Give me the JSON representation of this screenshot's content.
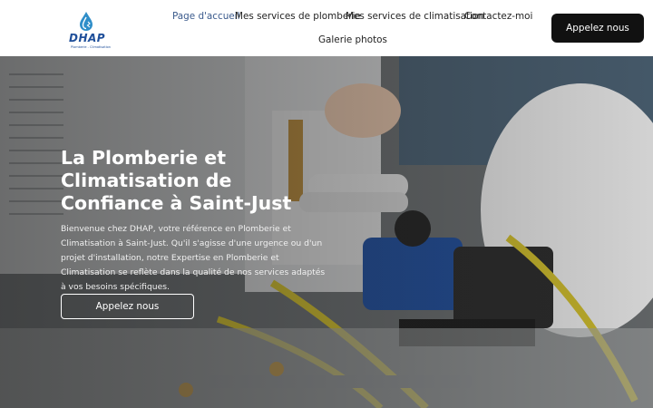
{
  "brand": {
    "logo_text": "DHAP",
    "logo_subtitle": "Plomberie - Climatisation",
    "accent_color": "#1f4f9a"
  },
  "nav": {
    "items": [
      {
        "label": "Page d'accueil",
        "active": true
      },
      {
        "label": "Mes services de plomberie",
        "active": false
      },
      {
        "label": "Mes services de climatisation",
        "active": false
      },
      {
        "label": "Contactez-moi",
        "active": false
      },
      {
        "label": "Galerie photos",
        "active": false
      }
    ],
    "call_button": "Appelez nous"
  },
  "hero": {
    "title": "La Plomberie et Climatisation de Confiance à Saint-Just",
    "text": "Bienvenue chez DHAP, votre référence en Plomberie et Climatisation à Saint-Just. Qu'il s'agisse d'une urgence ou d'un projet d'installation, notre Expertise en Plomberie et Climatisation se reflète dans la qualité de nos services adaptés à vos besoins spécifiques.",
    "button": "Appelez nous"
  },
  "colors": {
    "header_bg": "#ffffff",
    "button_bg": "#111111",
    "active_nav": "#3a5a8c"
  },
  "icons": [
    "water-drop-icon"
  ]
}
